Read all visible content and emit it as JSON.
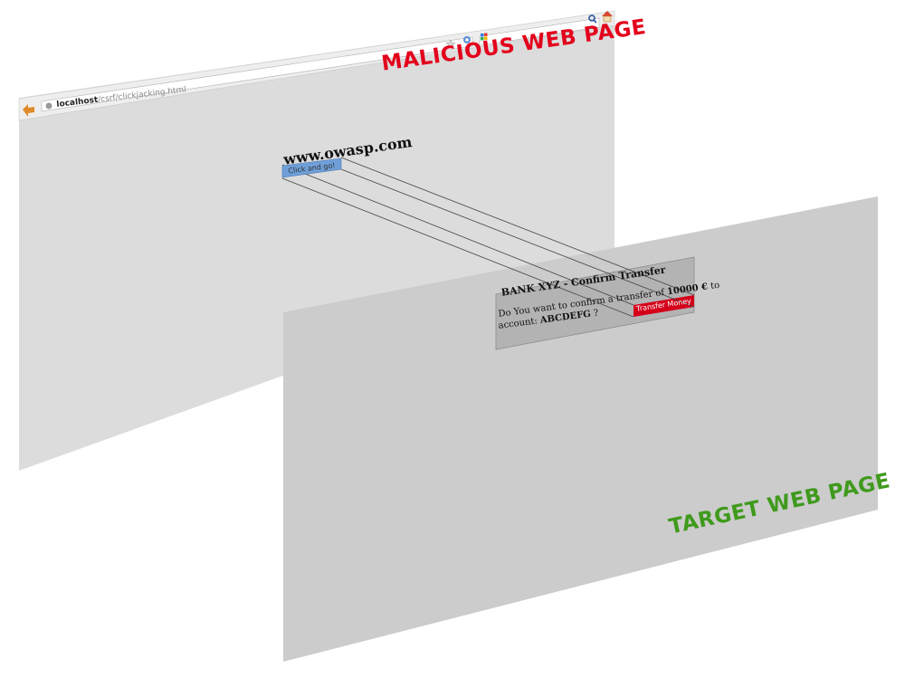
{
  "malicious": {
    "label": "MALICIOUS WEB PAGE",
    "url_host": "localhost",
    "url_path": "/csrf/clickjacking.html",
    "site_title": "www.owasp.com",
    "button_label": "Click and go!"
  },
  "target": {
    "label": "TARGET WEB PAGE",
    "bank_title": "BANK XYZ - Confirm Transfer",
    "prompt_prefix": "Do You want to confirm a transfer of ",
    "amount": "10000 €",
    "prompt_to": " to",
    "account_prefix": "account: ",
    "account": "ABCDEFG",
    "account_suffix": " ?",
    "button_label": "Transfer Money"
  },
  "colors": {
    "malicious_label": "#e3001b",
    "target_label": "#3f9a1c",
    "malicious_button": "#6f9fd8",
    "transfer_button": "#d4001a"
  },
  "icons": [
    "back-arrow-icon",
    "site-identity-icon",
    "star-icon",
    "reload-icon",
    "search-engine-icon",
    "search-icon",
    "home-icon"
  ]
}
